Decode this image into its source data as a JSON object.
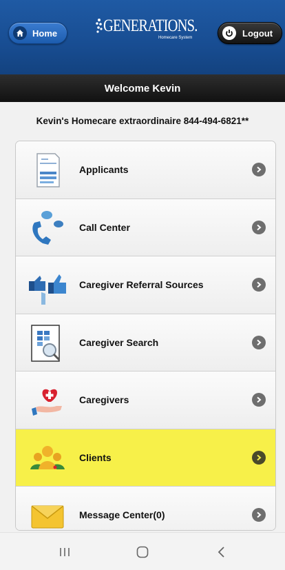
{
  "header": {
    "home_label": "Home",
    "logout_label": "Logout",
    "logo_text": "GENERATIONS.",
    "logo_subtext": "Homecare System",
    "brand_color": "#1f5aa4"
  },
  "welcome": "Welcome Kevin",
  "company_line": "Kevin's Homecare extraordinaire 844-494-6821**",
  "menu": [
    {
      "label": "Applicants",
      "icon": "applicants-form-icon"
    },
    {
      "label": "Call Center",
      "icon": "phone-chat-icon"
    },
    {
      "label": "Caregiver Referral Sources",
      "icon": "thumbs-up-icon"
    },
    {
      "label": "Caregiver Search",
      "icon": "search-document-icon"
    },
    {
      "label": "Caregivers",
      "icon": "heart-hand-icon"
    },
    {
      "label": "Clients",
      "icon": "people-group-icon",
      "highlighted": true
    },
    {
      "label": "Message Center(0)",
      "icon": "envelope-icon"
    }
  ],
  "colors": {
    "highlight": "#f7f049",
    "welcome_bar": "#1a1a1a"
  }
}
